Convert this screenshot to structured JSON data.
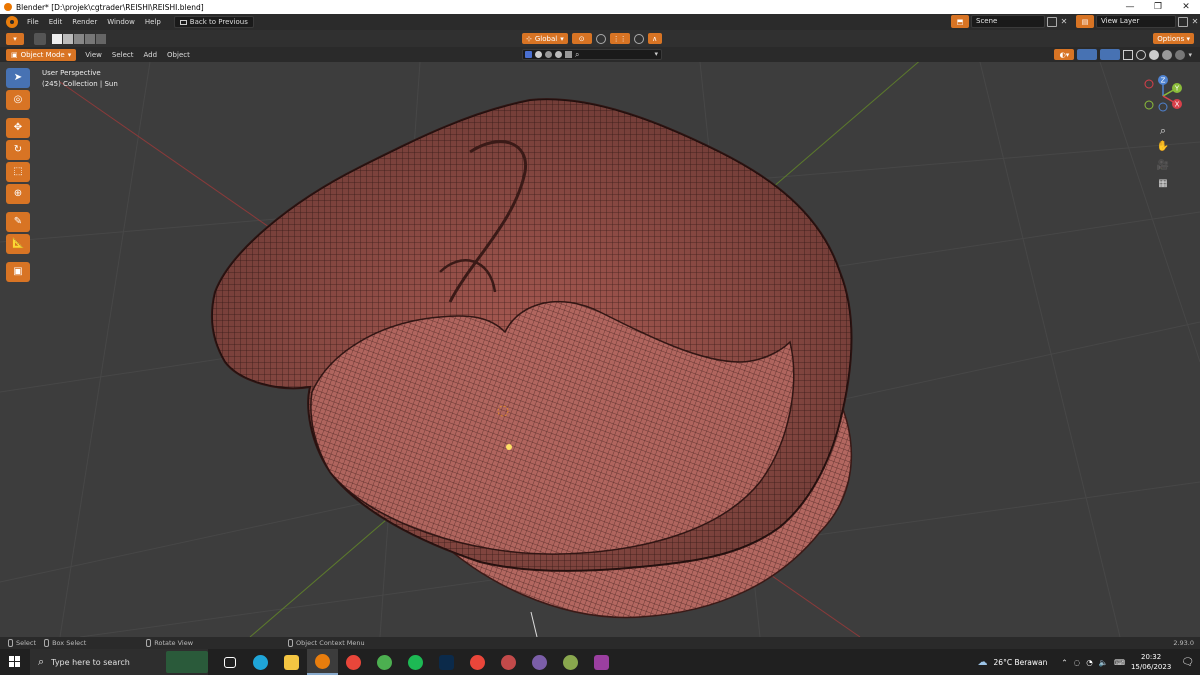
{
  "window": {
    "title": "Blender* [D:\\projek\\cgtrader\\REISHI\\REISHI.blend]",
    "controls": [
      "—",
      "❐",
      "✕"
    ]
  },
  "menubar": {
    "items": [
      "File",
      "Edit",
      "Render",
      "Window",
      "Help"
    ],
    "back_label": "Back to Previous",
    "scene_label": "Scene",
    "view_layer_label": "View Layer"
  },
  "tool_header": {
    "transform_orientation": "Global",
    "options_label": "Options"
  },
  "viewport_header": {
    "mode": "Object Mode",
    "menus": [
      "View",
      "Select",
      "Add",
      "Object"
    ]
  },
  "viewport": {
    "perspective": "User Perspective",
    "collection": "(245) Collection | Sun",
    "gizmo_axes": [
      "Z",
      "Y",
      "X"
    ]
  },
  "statusbar": {
    "select": "Select",
    "box_select": "Box Select",
    "rotate_view": "Rotate View",
    "context_menu": "Object Context Menu",
    "version": "2.93.0"
  },
  "taskbar": {
    "search_placeholder": "Type here to search",
    "weather": "26°C  Berawan",
    "time": "20:32",
    "date": "15/06/2023",
    "apps": [
      {
        "name": "task-view-icon",
        "color": "#ffffff"
      },
      {
        "name": "edge-icon",
        "color": "#1fa5d8"
      },
      {
        "name": "file-explorer-icon",
        "color": "#f4c542"
      },
      {
        "name": "blender-icon",
        "color": "#e87d0d"
      },
      {
        "name": "chrome-icon",
        "color": "#e9463a"
      },
      {
        "name": "chrome-profile-icon",
        "color": "#4caf50"
      },
      {
        "name": "spotify-icon",
        "color": "#1db954"
      },
      {
        "name": "photoshop-icon",
        "color": "#0b2a4a"
      },
      {
        "name": "chrome-alt-icon",
        "color": "#e9463a"
      },
      {
        "name": "app-icon-1",
        "color": "#c24a4a"
      },
      {
        "name": "app-icon-2",
        "color": "#7b5ea8"
      },
      {
        "name": "app-icon-3",
        "color": "#89a74e"
      },
      {
        "name": "winrar-icon",
        "color": "#9b3fa0"
      }
    ]
  },
  "colors": {
    "accent": "#d87424",
    "selected_tool": "#4772b3",
    "mesh": "#b0625a"
  }
}
